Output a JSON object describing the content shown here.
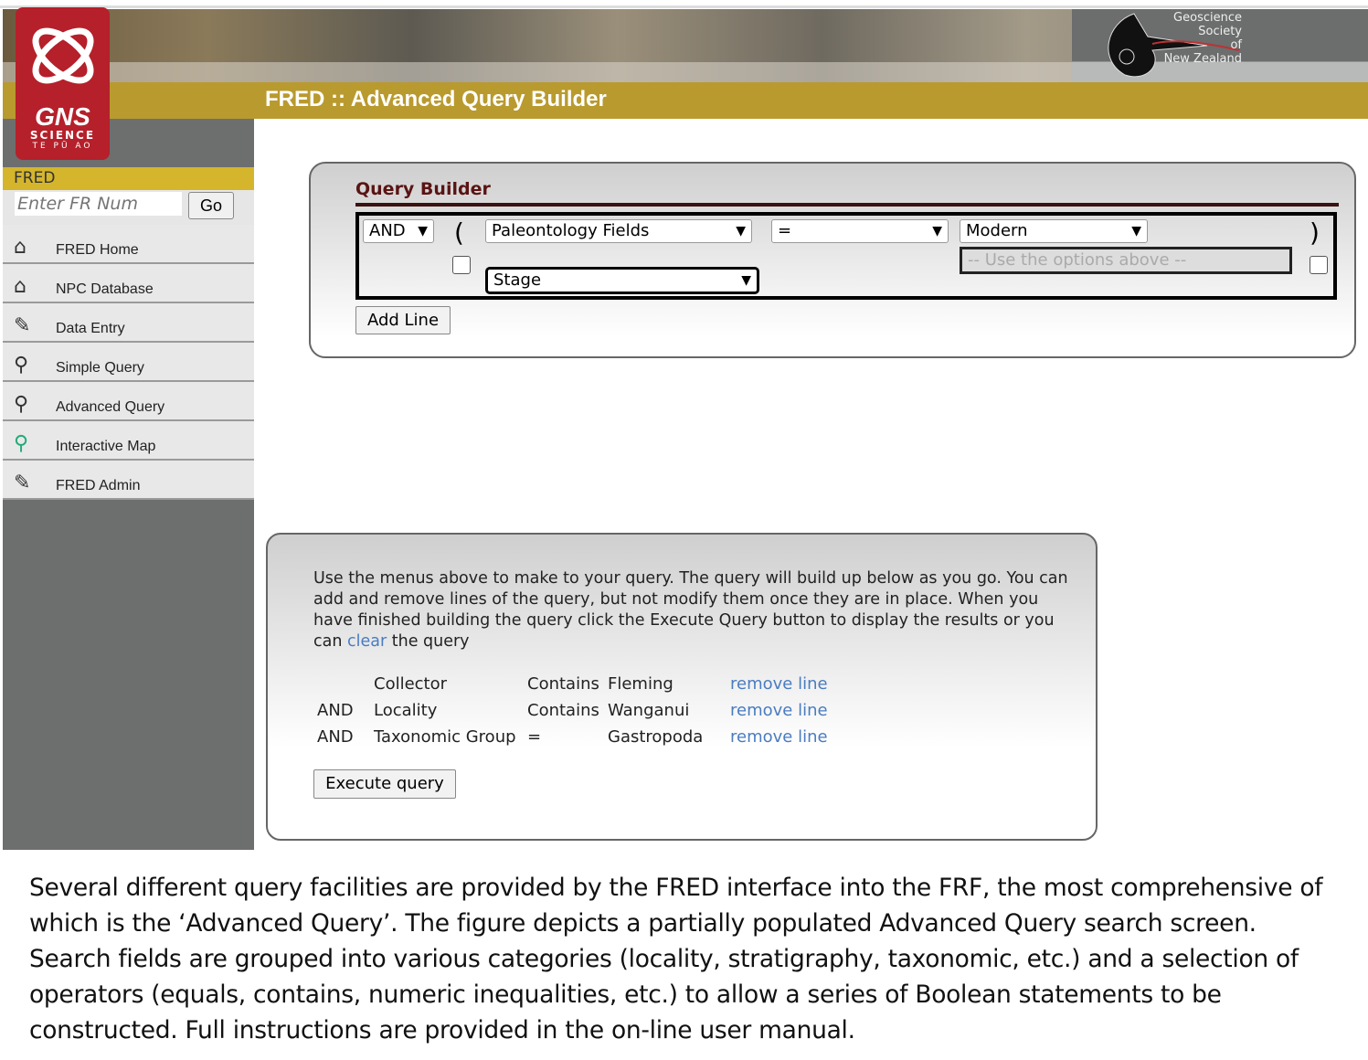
{
  "header": {
    "title": "FRED :: Advanced Query Builder",
    "logo_text": [
      "GNS",
      "SCIENCE",
      "TE PŪ AO"
    ],
    "society_logo": [
      "Geoscience",
      "Society",
      "of",
      "New Zealand"
    ]
  },
  "sidebar": {
    "section": "FRED",
    "fr_placeholder": "Enter FR Num",
    "go": "Go",
    "items": [
      {
        "label": "FRED Home",
        "icon": "house-icon"
      },
      {
        "label": "NPC Database",
        "icon": "house-icon"
      },
      {
        "label": "Data Entry",
        "icon": "pencil-icon"
      },
      {
        "label": "Simple Query",
        "icon": "magnifier-icon"
      },
      {
        "label": "Advanced Query",
        "icon": "magnifier-icon"
      },
      {
        "label": "Interactive Map",
        "icon": "map-icon"
      },
      {
        "label": "FRED Admin",
        "icon": "pencil-icon"
      }
    ]
  },
  "builder": {
    "heading": "Query Builder",
    "conjunction": "AND",
    "open_paren": "(",
    "close_paren": ")",
    "category": "Paleontology Fields",
    "field": "Stage",
    "operator": "=",
    "value": "Modern",
    "value_text_placeholder": "-- Use the options above --",
    "add_line": "Add Line"
  },
  "results": {
    "instructions_1": "Use the menus above to make to your query. The query will build up below as you go. You can add and remove lines of the query, but not modify them once they are in place. When you have finished building the query click the Execute Query button to display the results or you can ",
    "clear_link": "clear",
    "instructions_2": " the query",
    "lines": [
      {
        "conj": "",
        "field": "Collector",
        "op": "Contains",
        "value": "Fleming",
        "remove": "remove line"
      },
      {
        "conj": "AND",
        "field": "Locality",
        "op": "Contains",
        "value": "Wanganui",
        "remove": "remove line"
      },
      {
        "conj": "AND",
        "field": "Taxonomic Group",
        "op": "=",
        "value": "Gastropoda",
        "remove": "remove line"
      }
    ],
    "execute": "Execute query"
  },
  "caption": "Several different query facilities are provided by the FRED interface into the FRF, the most comprehensive of which is the ‘Advanced Query’. The figure depicts a partially populated Advanced Query search screen. Search fields are grouped into various categories (locality, stratigraphy, taxonomic, etc.) and a selection of operators (equals, contains, numeric inequalities, etc.) to allow a series of Boolean statements to be constructed. Full instructions are provided in the on-line user manual."
}
